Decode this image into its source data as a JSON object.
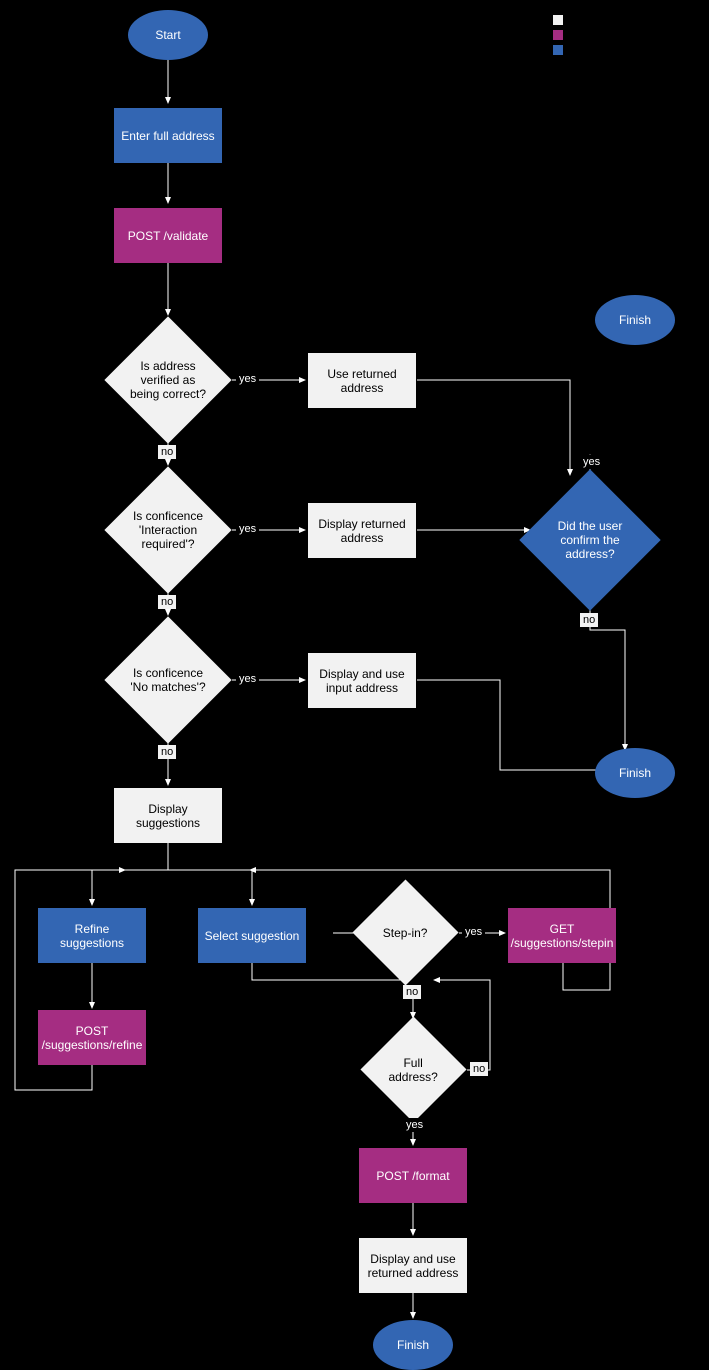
{
  "nodes": {
    "start": "Start",
    "enter": "Enter full address",
    "validate": "POST /validate",
    "verified": "Is address verified as being correct?",
    "useReturned": "Use returned address",
    "interaction": "Is conficence 'Interaction required'?",
    "displayReturned": "Display returned address",
    "nomatches": "Is conficence 'No matches'?",
    "displayInput": "Display and use input address",
    "displaySugg": "Display suggestions",
    "refine": "Refine suggestions",
    "selectSugg": "Select suggestion",
    "stepin": "Step-in?",
    "getStepin": "GET /suggestions/stepin",
    "fulladdr": "Full address?",
    "refinePost": "POST /suggestions/refine",
    "format": "POST /format",
    "displayUseReturned": "Display and use returned address",
    "finish": "Finish",
    "confirm": "Did the user confirm the address?"
  },
  "labels": {
    "yes": "yes",
    "no": "no"
  },
  "legend": {
    "white": "",
    "magenta": "",
    "blue": ""
  }
}
